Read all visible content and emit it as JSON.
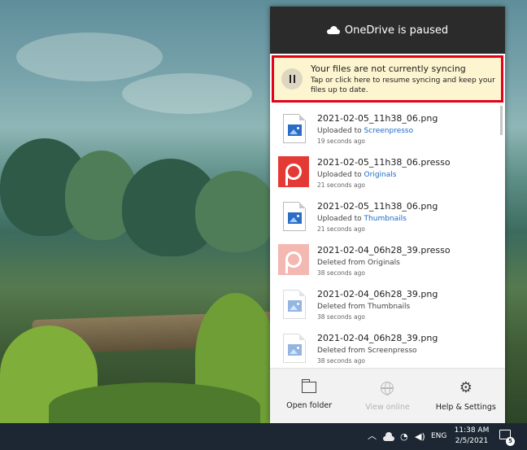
{
  "onedrive": {
    "header_title": "OneDrive is paused",
    "banner": {
      "title": "Your files are not currently syncing",
      "subtitle": "Tap or click here to resume syncing and keep your files up to date."
    },
    "files": [
      {
        "name": "2021-02-05_11h38_06.png",
        "status_prefix": "Uploaded to ",
        "status_link": "Screenpresso",
        "time": "19 seconds ago"
      },
      {
        "name": "2021-02-05_11h38_06.presso",
        "status_prefix": "Uploaded to ",
        "status_link": "Originals",
        "time": "21 seconds ago"
      },
      {
        "name": "2021-02-05_11h38_06.png",
        "status_prefix": "Uploaded to ",
        "status_link": "Thumbnails",
        "time": "21 seconds ago"
      },
      {
        "name": "2021-02-04_06h28_39.presso",
        "status_prefix": "Deleted from Originals",
        "status_link": "",
        "time": "38 seconds ago"
      },
      {
        "name": "2021-02-04_06h28_39.png",
        "status_prefix": "Deleted from Thumbnails",
        "status_link": "",
        "time": "38 seconds ago"
      },
      {
        "name": "2021-02-04_06h28_39.png",
        "status_prefix": "Deleted from Screenpresso",
        "status_link": "",
        "time": "38 seconds ago"
      }
    ],
    "footer": {
      "open_folder": "Open folder",
      "view_online": "View online",
      "help_settings": "Help & Settings"
    }
  },
  "taskbar": {
    "language": "ENG",
    "time": "11:38 AM",
    "date": "2/5/2021",
    "notification_count": "5"
  }
}
